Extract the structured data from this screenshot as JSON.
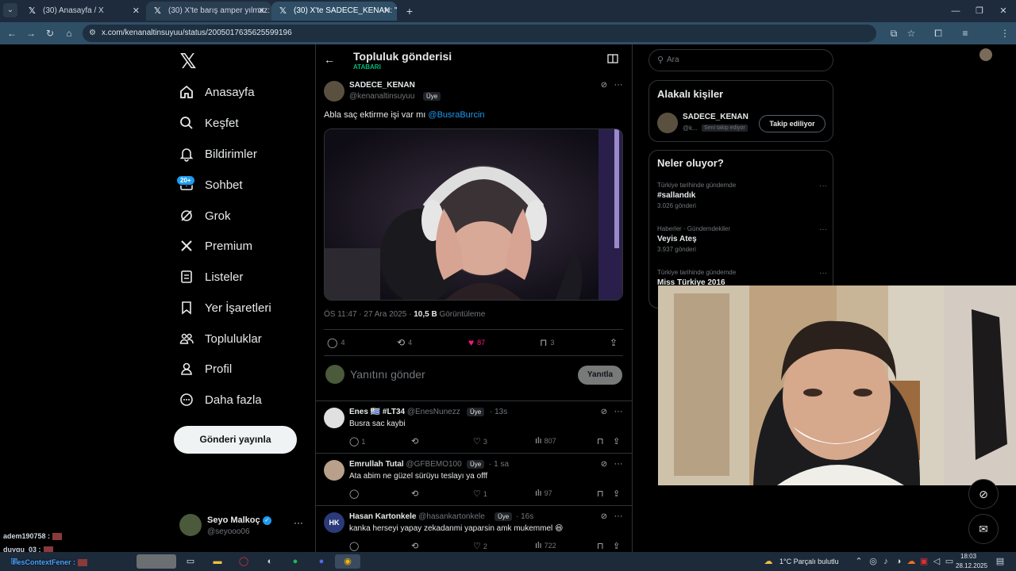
{
  "browser": {
    "tabs": [
      {
        "title": "(30) Anasayfa / X"
      },
      {
        "title": "(30) X'te barış amper yılmaz:"
      },
      {
        "title": "(30) X'te SADECE_KENAN: \"Abla"
      }
    ],
    "url": "x.com/kenanaltinsuyuu/status/2005017635625599196"
  },
  "nav": {
    "items": [
      {
        "label": "Anasayfa"
      },
      {
        "label": "Keşfet"
      },
      {
        "label": "Bildirimler"
      },
      {
        "label": "Sohbet"
      },
      {
        "label": "Grok"
      },
      {
        "label": "Premium"
      },
      {
        "label": "Listeler"
      },
      {
        "label": "Yer İşaretleri"
      },
      {
        "label": "Topluluklar"
      },
      {
        "label": "Profil"
      },
      {
        "label": "Daha fazla"
      }
    ],
    "chat_badge": "20+",
    "post_button": "Gönderi yayınla",
    "account": {
      "name": "Seyo Malkoç",
      "handle": "@seyooo06"
    }
  },
  "header": {
    "title": "Topluluk gönderisi",
    "subtitle": "ATABARI"
  },
  "post": {
    "author": "SADECE_KENAN",
    "handle": "@kenanaltinsuyuu",
    "member_tag": "Üye",
    "text": "Abla saç ektirme işi var mı ",
    "mention": "@BusraBurcin",
    "time": "ÖS 11:47 · 27 Ara 2025 · ",
    "views_count": "10,5 B",
    "views_label": " Görüntüleme",
    "stats": {
      "replies": "4",
      "reposts": "4",
      "likes": "87",
      "bookmarks": "3"
    }
  },
  "reply_box": {
    "placeholder": "Yanıtını gönder",
    "button": "Yanıtla"
  },
  "comments": [
    {
      "name": "Enes 🇺🇾 #LT34",
      "handle": "@EnesNunezz",
      "tag": "Üye",
      "time": "· 13s",
      "text": "Busra sac kaybi",
      "replies": "1",
      "reposts": "",
      "likes": "3",
      "views": "807"
    },
    {
      "name": "Emrullah Tutal",
      "handle": "@GFBEMO100",
      "tag": "Üye",
      "time": "· 1 sa",
      "text": "Ata abim ne güzel sürüyu teslayı ya offf",
      "replies": "",
      "reposts": "",
      "likes": "1",
      "views": "97"
    },
    {
      "name": "Hasan Kartonkele",
      "handle": "@hasankartonkele",
      "tag": "Üye",
      "time": "· 16s",
      "text": "kanka herseyi yapay zekadanmi yaparsin amk mukemmel 😆",
      "replies": "",
      "reposts": "",
      "likes": "2",
      "views": "722"
    }
  ],
  "right": {
    "search_placeholder": "Ara",
    "related_title": "Alakalı kişiler",
    "related": {
      "name": "SADECE_KENAN",
      "handle": "@k...",
      "follows_you": "Seni takip ediyor",
      "button": "Takip ediliyor"
    },
    "trends_title": "Neler oluyor?",
    "trends": [
      {
        "context": "Türkiye tarihinde gündemde",
        "name": "#sallandık",
        "posts": "3.026 gönderi"
      },
      {
        "context": "Haberler · Gündemdekiler",
        "name": "Veyis Ateş",
        "posts": "3.937 gönderi"
      },
      {
        "context": "Türkiye tarihinde gündemde",
        "name": "Miss Türkiye 2016",
        "posts": ""
      }
    ]
  },
  "chat": [
    {
      "user": "adem190758 :"
    },
    {
      "user": "duygu_03 :"
    },
    {
      "user": "FesContextFener :"
    }
  ],
  "taskbar": {
    "weather": "1°C  Parçalı bulutlu",
    "time": "18:03",
    "date": "28.12.2025"
  }
}
